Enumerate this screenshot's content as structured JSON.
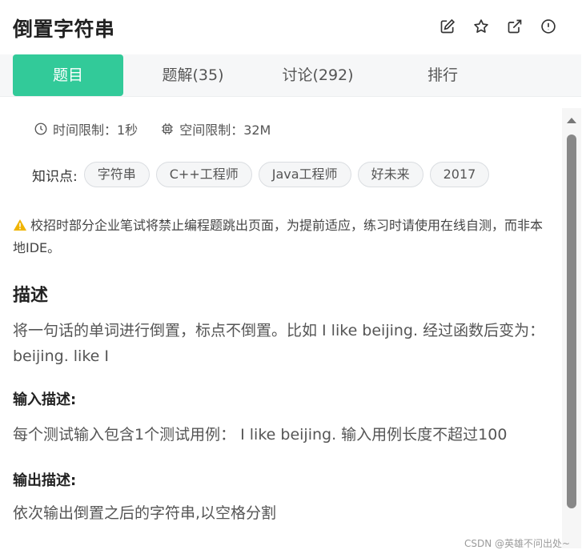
{
  "header": {
    "title": "倒置字符串",
    "icons": [
      "edit-icon",
      "star-icon",
      "external-link-icon",
      "alert-circle-icon"
    ]
  },
  "tabs": [
    {
      "label": "题目",
      "active": true
    },
    {
      "label": "题解(35)",
      "active": false
    },
    {
      "label": "讨论(292)",
      "active": false
    },
    {
      "label": "排行",
      "active": false
    }
  ],
  "limits": {
    "time": "时间限制：1秒",
    "space": "空间限制：32M"
  },
  "tags": {
    "label": "知识点:",
    "items": [
      "字符串",
      "C++工程师",
      "Java工程师",
      "好未来",
      "2017"
    ]
  },
  "notice": "校招时部分企业笔试将禁止编程题跳出页面，为提前适应，练习时请使用在线自测，而非本地IDE。",
  "description": {
    "heading": "描述",
    "text": "将一句话的单词进行倒置，标点不倒置。比如 I like beijing. 经过函数后变为：beijing. like I"
  },
  "input_desc": {
    "heading": "输入描述:",
    "text": "每个测试输入包含1个测试用例： I like beijing. 输入用例长度不超过100"
  },
  "output_desc": {
    "heading": "输出描述:",
    "text": "依次输出倒置之后的字符串,以空格分割"
  },
  "watermark": "CSDN @英雄不问出处~",
  "colors": {
    "accent": "#32ca99",
    "warning": "#f0b400"
  }
}
